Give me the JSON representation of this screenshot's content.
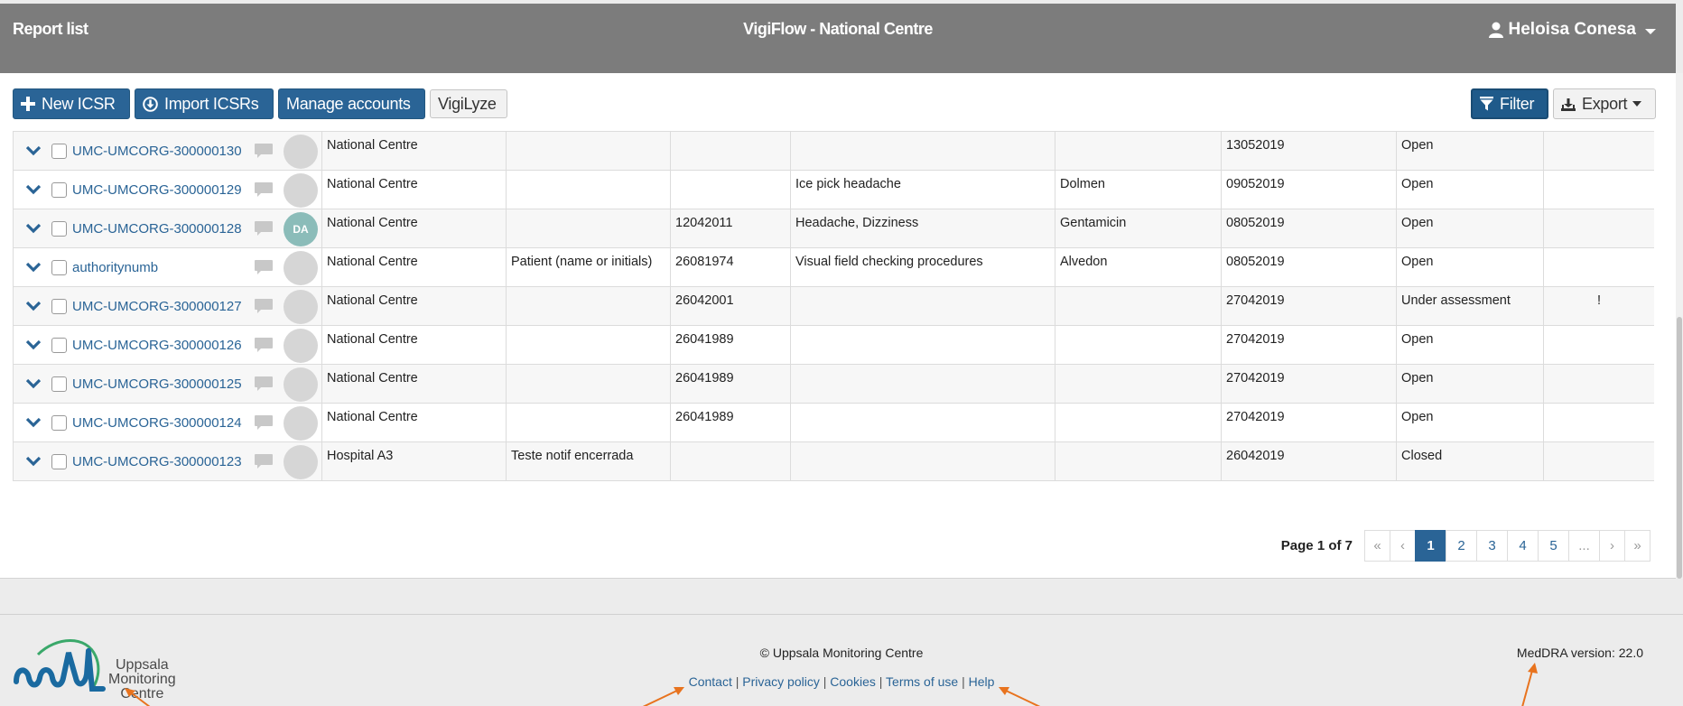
{
  "header": {
    "page_label": "Report list",
    "app_title": "VigiFlow -  National Centre",
    "user_name": "Heloisa Conesa"
  },
  "toolbar": {
    "new_icsr": "New ICSR",
    "import_icsrs": "Import ICSRs",
    "manage_accounts": "Manage accounts",
    "vigilyze": "VigiLyze",
    "filter": "Filter",
    "export": "Export"
  },
  "rows": [
    {
      "id": "UMC-UMCORG-300000130",
      "avatar": "",
      "org": "National Centre",
      "patient": "",
      "dob": "",
      "reaction": "",
      "drug": "",
      "date": "13052019",
      "status": "Open",
      "flag": ""
    },
    {
      "id": "UMC-UMCORG-300000129",
      "avatar": "",
      "org": "National Centre",
      "patient": "",
      "dob": "",
      "reaction": "Ice pick headache",
      "drug": "Dolmen",
      "date": "09052019",
      "status": "Open",
      "flag": ""
    },
    {
      "id": "UMC-UMCORG-300000128",
      "avatar": "DA",
      "org": "National Centre",
      "patient": "",
      "dob": "12042011",
      "reaction": "Headache, Dizziness",
      "drug": "Gentamicin",
      "date": "08052019",
      "status": "Open",
      "flag": ""
    },
    {
      "id": "authoritynumb",
      "avatar": "",
      "org": "National Centre",
      "patient": "Patient (name or initials)",
      "dob": "26081974",
      "reaction": "Visual field checking procedures",
      "drug": "Alvedon",
      "date": "08052019",
      "status": "Open",
      "flag": ""
    },
    {
      "id": "UMC-UMCORG-300000127",
      "avatar": "",
      "org": "National Centre",
      "patient": "",
      "dob": "26042001",
      "reaction": "",
      "drug": "",
      "date": "27042019",
      "status": "Under assessment",
      "flag": "!"
    },
    {
      "id": "UMC-UMCORG-300000126",
      "avatar": "",
      "org": "National Centre",
      "patient": "",
      "dob": "26041989",
      "reaction": "",
      "drug": "",
      "date": "27042019",
      "status": "Open",
      "flag": ""
    },
    {
      "id": "UMC-UMCORG-300000125",
      "avatar": "",
      "org": "National Centre",
      "patient": "",
      "dob": "26041989",
      "reaction": "",
      "drug": "",
      "date": "27042019",
      "status": "Open",
      "flag": ""
    },
    {
      "id": "UMC-UMCORG-300000124",
      "avatar": "",
      "org": "National Centre",
      "patient": "",
      "dob": "26041989",
      "reaction": "",
      "drug": "",
      "date": "27042019",
      "status": "Open",
      "flag": ""
    },
    {
      "id": "UMC-UMCORG-300000123",
      "avatar": "",
      "org": "Hospital A3",
      "patient": "Teste notif encerrada",
      "dob": "",
      "reaction": "",
      "drug": "",
      "date": "26042019",
      "status": "Closed",
      "flag": ""
    }
  ],
  "pagination": {
    "label": "Page 1 of 7",
    "first": "«",
    "prev": "‹",
    "pages": [
      "1",
      "2",
      "3",
      "4",
      "5"
    ],
    "current": "1",
    "ellipsis": "...",
    "next": "›",
    "last": "»"
  },
  "footer": {
    "logo_line1": "Uppsala",
    "logo_line2": "Monitoring",
    "logo_line3": "Centre",
    "copyright": "© Uppsala Monitoring Centre",
    "links": [
      "Contact",
      "Privacy policy",
      "Cookies",
      "Terms of use",
      "Help"
    ],
    "separator": "|",
    "meddra": "MedDRA version:  22.0"
  },
  "colors": {
    "header_bg": "#7c7c7c",
    "primary": "#2a6496",
    "annotation_arrow": "#e8731e"
  }
}
